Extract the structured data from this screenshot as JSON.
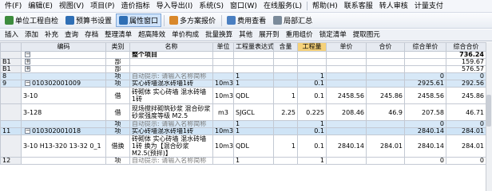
{
  "menu": [
    "件(F)",
    "编辑(E)",
    "视图(V)",
    "项目(P)",
    "造价指标",
    "导入导出(I)",
    "系统(S)",
    "窗口(W)",
    "在线服务(L)",
    "帮助(H)",
    "联系客服",
    "转人审核",
    "计量支付"
  ],
  "toolbar1": [
    {
      "label": "单位工程自检",
      "icon": "#3d8c3d"
    },
    {
      "label": "预算书设置",
      "icon": "#2f6fb5"
    },
    {
      "label": "属性窗口",
      "icon": "#2f6fb5",
      "active": true
    },
    {
      "label": "多方案报价",
      "icon": "#d9882b"
    },
    {
      "label": "费用查看",
      "icon": "#4a7fc1"
    },
    {
      "label": "局部汇总",
      "icon": "#7a8a9a"
    }
  ],
  "toolbar2": [
    "插入",
    "添加",
    "补充",
    "查询",
    "存档",
    "整理清单",
    "超高降效",
    "单价构成",
    "批量换算",
    "其他",
    "展开到",
    "重用组价",
    "锁定清单",
    "提取图元"
  ],
  "columns": [
    "",
    "编码",
    "类别",
    "名称",
    "单位",
    "工程量表达式",
    "含量",
    "工程量",
    "单价",
    "合价",
    "综合单价",
    "综合合价"
  ],
  "rows": [
    {
      "idx": "",
      "code": "",
      "cat": "",
      "name": "整个项目",
      "unit": "",
      "expr": "",
      "cont": "",
      "qty": "",
      "price": "",
      "total": "",
      "uprice": "",
      "utotal": "736.24",
      "type": "root"
    },
    {
      "idx": "B1",
      "code": "",
      "cat": "部",
      "name": "",
      "unit": "",
      "expr": "",
      "cont": "",
      "qty": "",
      "price": "",
      "total": "",
      "uprice": "",
      "utotal": "159.67",
      "type": "part"
    },
    {
      "idx": "B1",
      "code": "",
      "cat": "部",
      "name": "",
      "unit": "",
      "expr": "",
      "cont": "",
      "qty": "",
      "price": "",
      "total": "",
      "uprice": "",
      "utotal": "576.57",
      "type": "part"
    },
    {
      "idx": "8",
      "code": "",
      "cat": "项",
      "name": "自动提示: 请输入名称简称",
      "unit": "",
      "expr": "1",
      "cont": "",
      "qty": "1",
      "price": "",
      "total": "",
      "uprice": "0",
      "utotal": "0",
      "type": "blue"
    },
    {
      "idx": "9",
      "code": "010302001009",
      "cat": "项",
      "name": "实心砖墙混水砖墙1砖",
      "unit": "10m3",
      "expr": "1",
      "cont": "",
      "qty": "0.1",
      "price": "",
      "total": "",
      "uprice": "2925.61",
      "utotal": "292.56",
      "type": "blue"
    },
    {
      "idx": "",
      "code": "3-10",
      "cat": "借",
      "name": "砖砌体 实心砖墙 混水砖墙 1砖",
      "unit": "10m3",
      "expr": "QDL",
      "cont": "1",
      "qty": "0.1",
      "price": "2458.56",
      "total": "245.86",
      "uprice": "2458.56",
      "utotal": "245.86",
      "type": "tall"
    },
    {
      "idx": "",
      "code": "3-128",
      "cat": "借",
      "name": "现场搅拌砌筑砂浆 混合砂浆 砂浆强度等级 M2.5",
      "unit": "m3",
      "expr": "SJGCL",
      "cont": "2.25",
      "qty": "0.225",
      "price": "208.46",
      "total": "46.9",
      "uprice": "207.58",
      "utotal": "46.71",
      "type": "tall"
    },
    {
      "idx": "",
      "code": "",
      "cat": "项",
      "name": "自动提示: 请输入名称简称",
      "unit": "",
      "expr": "1",
      "cont": "",
      "qty": "1",
      "price": "",
      "total": "",
      "uprice": "0",
      "utotal": "0",
      "type": "blue"
    },
    {
      "idx": "11",
      "code": "010302001018",
      "cat": "项",
      "name": "实心砖墙混水砖墙1砖",
      "unit": "10m3",
      "expr": "1",
      "cont": "",
      "qty": "0.1",
      "price": "",
      "total": "",
      "uprice": "2840.14",
      "utotal": "284.01",
      "type": "sel"
    },
    {
      "idx": "",
      "code": "3-10 H13-320 13-32 0_1",
      "cat": "借换",
      "name": "砖砌体 实心砖墙 混水砖墙 1砖 换为【混合砂浆 M2.5(预拌)】",
      "unit": "10m3",
      "expr": "QDL",
      "cont": "1",
      "qty": "0.1",
      "price": "2840.14",
      "total": "284.01",
      "uprice": "2840.14",
      "utotal": "284.01",
      "type": "tall"
    },
    {
      "idx": "12",
      "code": "",
      "cat": "项",
      "name": "自动提示: 请输入名称简称",
      "unit": "",
      "expr": "1",
      "cont": "",
      "qty": "1",
      "price": "",
      "total": "",
      "uprice": "0",
      "utotal": "0",
      "type": "plain"
    }
  ]
}
